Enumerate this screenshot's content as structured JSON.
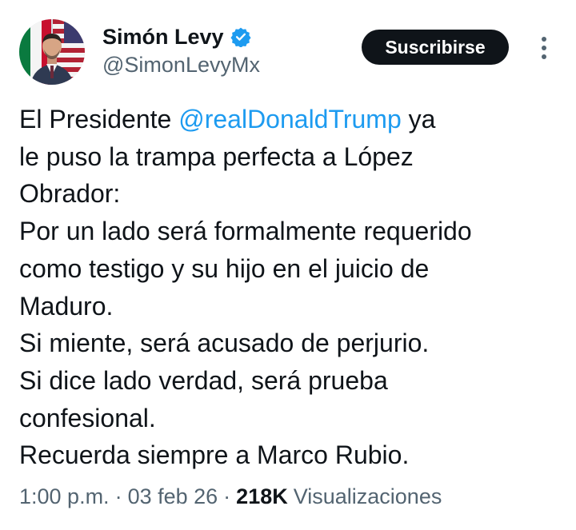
{
  "author": {
    "display_name": "Simón Levy",
    "handle": "@SimonLevyMx"
  },
  "subscribe_label": "Suscribirse",
  "tweet": {
    "line1_pre": "El Presidente ",
    "mention": "@realDonaldTrump",
    "line1_post": " ya",
    "lines": [
      "le puso la trampa perfecta a López",
      "Obrador:",
      "Por un lado será formalmente requerido",
      "como testigo y su hijo en el juicio de",
      "Maduro.",
      "Si miente, será acusado de perjurio.",
      "Si dice lado verdad, será prueba",
      "confesional.",
      "Recuerda siempre a Marco Rubio."
    ]
  },
  "meta": {
    "time": "1:00 p.m.",
    "separator": "·",
    "date": "03 feb 26",
    "views_count": "218K",
    "views_label": "Visualizaciones"
  },
  "colors": {
    "text": "#0f1419",
    "secondary": "#536471",
    "link": "#1d9bf0",
    "verified": "#1d9bf0",
    "button_bg": "#0f1419"
  },
  "icons": {
    "verified": "verified-badge-icon",
    "more": "more-vertical-icon"
  }
}
